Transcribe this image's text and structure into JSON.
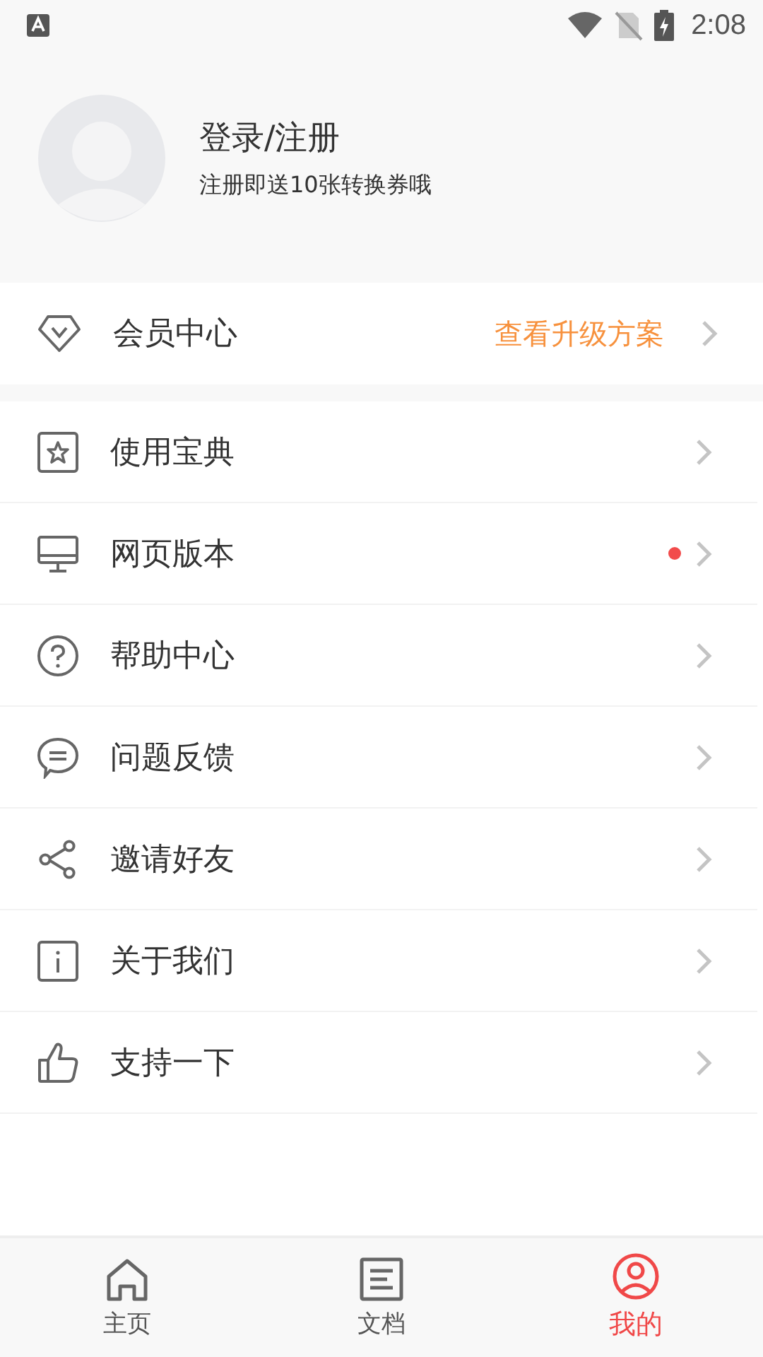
{
  "status_bar": {
    "time": "2:08"
  },
  "profile": {
    "title": "登录/注册",
    "subtitle": "注册即送10张转换券哦"
  },
  "membership": {
    "label": "会员中心",
    "action": "查看升级方案"
  },
  "menu": [
    {
      "label": "使用宝典",
      "dot": false
    },
    {
      "label": "网页版本",
      "dot": true
    },
    {
      "label": "帮助中心",
      "dot": false
    },
    {
      "label": "问题反馈",
      "dot": false
    },
    {
      "label": "邀请好友",
      "dot": false
    },
    {
      "label": "关于我们",
      "dot": false
    },
    {
      "label": "支持一下",
      "dot": false
    }
  ],
  "tabs": [
    {
      "label": "主页",
      "selected": false
    },
    {
      "label": "文档",
      "selected": false
    },
    {
      "label": "我的",
      "selected": true
    }
  ]
}
